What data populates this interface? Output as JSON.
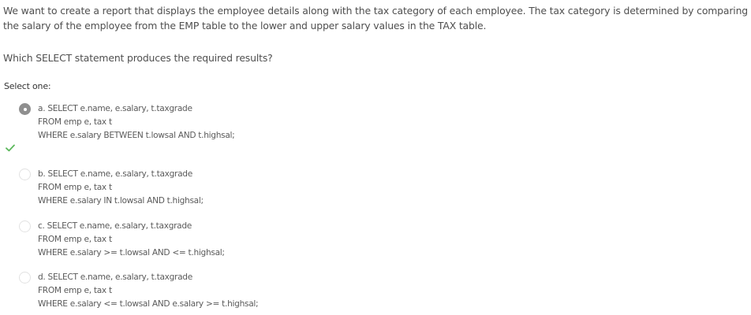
{
  "question": {
    "stem": "We want to create a report that displays the employee details along with the tax category of each employee. The tax category is determined by comparing the salary of the employee from the EMP table to the lower and upper salary values in the TAX table.",
    "prompt": "Which SELECT statement produces the required results?",
    "select_label": "Select one:"
  },
  "answers": [
    {
      "selected": true,
      "correct": true,
      "lines": [
        "a. SELECT e.name, e.salary, t.taxgrade",
        "FROM emp e, tax t",
        "WHERE e.salary BETWEEN t.lowsal AND t.highsal;"
      ]
    },
    {
      "selected": false,
      "lines": [
        "b. SELECT e.name, e.salary, t.taxgrade",
        "FROM emp e, tax t",
        "WHERE e.salary IN t.lowsal AND t.highsal;"
      ]
    },
    {
      "selected": false,
      "lines": [
        "c. SELECT e.name, e.salary, t.taxgrade",
        "FROM emp e, tax t",
        "WHERE e.salary >= t.lowsal AND <= t.highsal;"
      ]
    },
    {
      "selected": false,
      "lines": [
        "d. SELECT e.name, e.salary, t.taxgrade",
        "FROM emp e, tax t",
        "WHERE e.salary <= t.lowsal AND e.salary >= t.highsal;"
      ]
    }
  ],
  "colors": {
    "check": "#5cb85c",
    "radio_selected": "#8f8f8f"
  },
  "icons": {
    "correct": "check-icon"
  }
}
